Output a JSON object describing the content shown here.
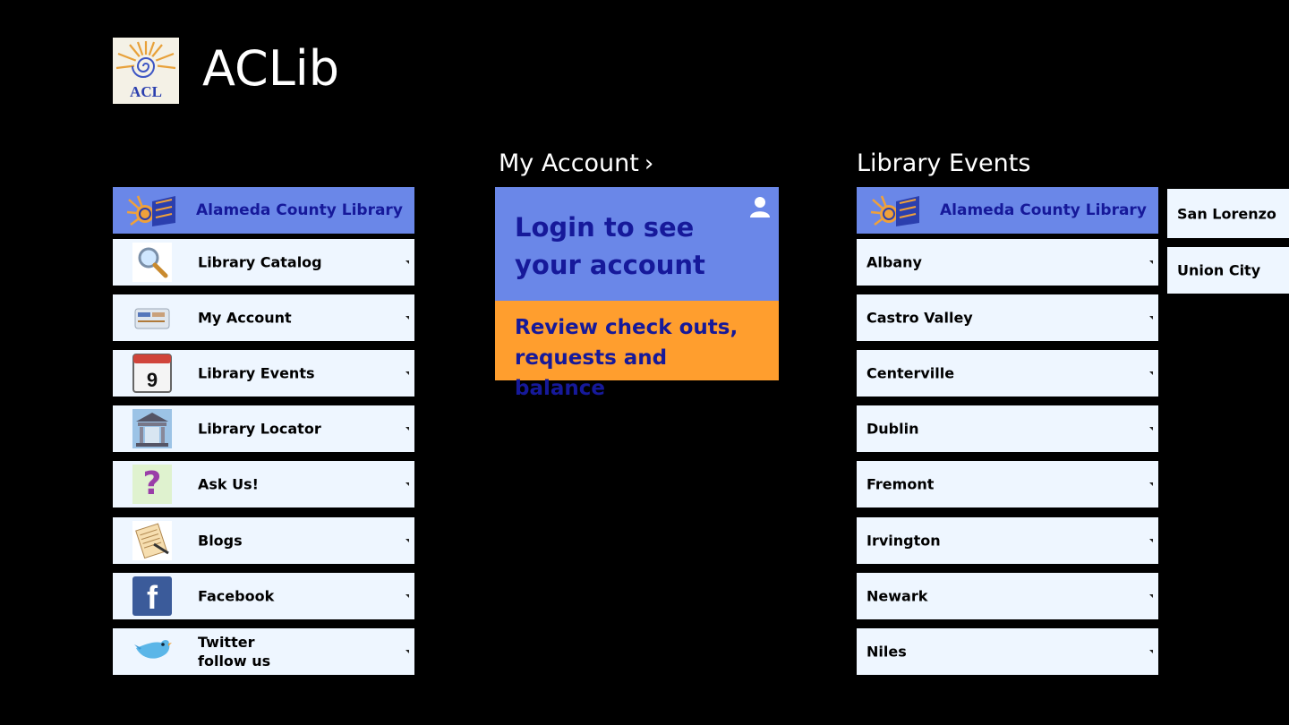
{
  "app": {
    "title": "ACLib",
    "logo_text": "ACL"
  },
  "colors": {
    "tile_bg": "#eef6ff",
    "header_tile_bg": "#6a87e8",
    "header_tile_text": "#16199a",
    "account_tile_bg": "#6a87e8",
    "review_tile_bg": "#ff9e2e"
  },
  "left_column": {
    "header_tile": {
      "label": "Alameda County Library",
      "icon": "acl-logo-icon"
    },
    "items": [
      {
        "label": "Library Catalog",
        "icon": "magnifier-icon"
      },
      {
        "label": "My Account",
        "icon": "library-card-icon"
      },
      {
        "label": "Library Events",
        "icon": "calendar-icon",
        "calendar_day": "9"
      },
      {
        "label": "Library Locator",
        "icon": "building-icon"
      },
      {
        "label": "Ask Us!",
        "icon": "question-icon",
        "glyph": "?"
      },
      {
        "label": "Blogs",
        "icon": "notepad-icon"
      },
      {
        "label": "Facebook",
        "icon": "facebook-icon",
        "glyph": "f"
      },
      {
        "label": "Twitter",
        "label2": "follow us",
        "icon": "twitter-bird-icon"
      }
    ]
  },
  "my_account": {
    "heading": "My Account",
    "chevron": "›",
    "login_text": "Login to see your account",
    "review_text": "Review check outs, requests and balance"
  },
  "library_events": {
    "heading": "Library Events",
    "header_tile": {
      "label": "Alameda County Library",
      "icon": "acl-logo-icon"
    },
    "branches": [
      "Albany",
      "Castro Valley",
      "Centerville",
      "Dublin",
      "Fremont",
      "Irvington",
      "Newark",
      "Niles"
    ],
    "overflow_branches": [
      "San Lorenzo",
      "Union City"
    ]
  }
}
